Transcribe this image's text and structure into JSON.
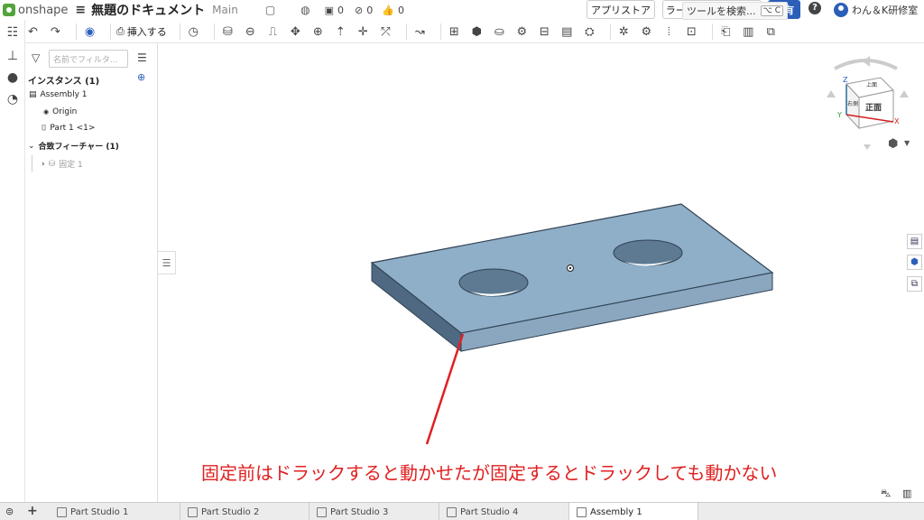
{
  "app": {
    "logo_text": "onshape",
    "document_title": "無題のドキュメント",
    "workspace": "Main",
    "counts": {
      "copies": "0",
      "links": "0",
      "likes": "0"
    }
  },
  "header": {
    "app_store": "アプリストア",
    "learning_center": "ラーニング センター",
    "share": "共有",
    "user_name": "わん＆K研修室"
  },
  "toolbar": {
    "insert_label": "挿入する",
    "search_tools": "ツールを検索...",
    "shortcut": "⌥ C"
  },
  "panel": {
    "filter_placeholder": "名前でフィルタ...",
    "instances_header": "インスタンス (1)",
    "assembly": "Assembly 1",
    "origin": "Origin",
    "part": "Part 1 <1>",
    "mates_header": "合致フィーチャー (1)",
    "fixed": "固定 1"
  },
  "viewcube": {
    "front": "正面",
    "top": "上面",
    "right": "右側",
    "axis_x": "X",
    "axis_y": "Y",
    "axis_z": "Z"
  },
  "annotation": "固定前はドラックすると動かせたが固定するとドラックしても動かない",
  "tabs": [
    "Part Studio 1",
    "Part Studio 2",
    "Part Studio 3",
    "Part Studio 4",
    "Assembly 1"
  ],
  "active_tab": "Assembly 1",
  "colors": {
    "part_top": "#8fafc8",
    "part_side": "#6d8aa6",
    "part_front": "#597691",
    "annotation": "#e02020",
    "share": "#2b5fb8"
  }
}
